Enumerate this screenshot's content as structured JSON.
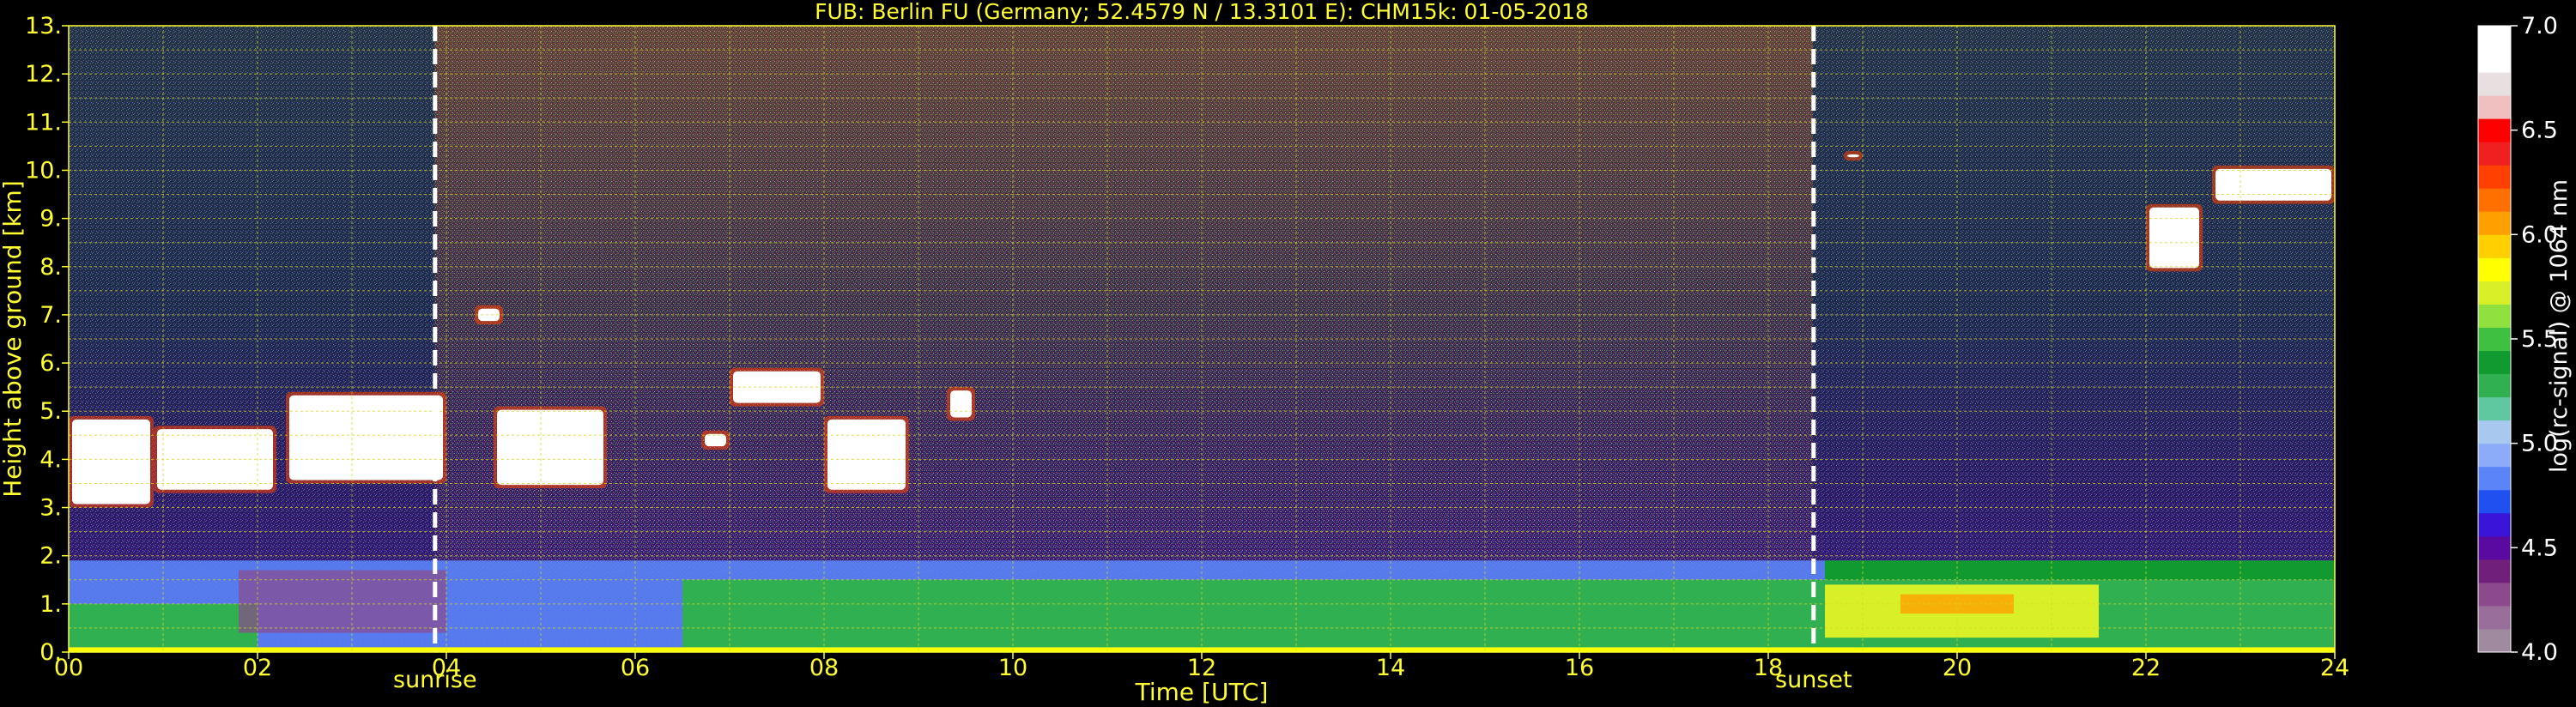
{
  "chart_data": {
    "type": "heatmap",
    "title": "FUB: Berlin FU (Germany; 52.4579 N / 13.3101 E):    CHM15k: 01-05-2018",
    "xlabel": "Time [UTC]",
    "ylabel": "Height above ground [km]",
    "xlim": [
      0,
      24
    ],
    "ylim": [
      0,
      13
    ],
    "x_ticks": [
      "00",
      "02",
      "04",
      "06",
      "08",
      "10",
      "12",
      "14",
      "16",
      "18",
      "20",
      "22",
      "24"
    ],
    "y_ticks": [
      "0.",
      "1.",
      "2.",
      "3.",
      "4.",
      "5.",
      "6.",
      "7.",
      "8.",
      "9.",
      "10.",
      "11.",
      "12.",
      "13."
    ],
    "grid": true,
    "markers": [
      {
        "label": "sunrise",
        "time": 3.88
      },
      {
        "label": "sunset",
        "time": 18.48
      }
    ],
    "colorbar": {
      "label": "log(rc-signal) @ 1064 nm",
      "range": [
        4.0,
        7.0
      ],
      "ticks": [
        "4.0",
        "4.5",
        "5.0",
        "5.5",
        "6.0",
        "6.5",
        "7.0"
      ],
      "colors": [
        "#a08aa0",
        "#9a6e9a",
        "#8c4a8c",
        "#70207a",
        "#5a0aa0",
        "#3a14d8",
        "#2050f0",
        "#5a84f8",
        "#8cacfa",
        "#a8c8f0",
        "#60c8a0",
        "#30b050",
        "#109a30",
        "#40c040",
        "#90e040",
        "#d8f028",
        "#ffff00",
        "#ffd000",
        "#ffa000",
        "#ff7000",
        "#ff4000",
        "#f02020",
        "#ff0000",
        "#f0c0c0",
        "#e8e0e0",
        "#ffffff",
        "#ffffff"
      ]
    },
    "features": [
      {
        "name": "boundary layer aerosol",
        "x": [
          0,
          24
        ],
        "y": [
          0,
          1.9
        ]
      },
      {
        "name": "cloud",
        "x": [
          0,
          0.9
        ],
        "y": [
          3.0,
          4.9
        ]
      },
      {
        "name": "cloud",
        "x": [
          0.9,
          2.2
        ],
        "y": [
          3.3,
          4.7
        ]
      },
      {
        "name": "cloud",
        "x": [
          2.3,
          4.0
        ],
        "y": [
          3.5,
          5.4
        ]
      },
      {
        "name": "cloud",
        "x": [
          4.5,
          5.7
        ],
        "y": [
          3.4,
          5.1
        ]
      },
      {
        "name": "cloud",
        "x": [
          4.3,
          4.6
        ],
        "y": [
          6.8,
          7.2
        ]
      },
      {
        "name": "cloud",
        "x": [
          6.7,
          7.0
        ],
        "y": [
          4.2,
          4.6
        ]
      },
      {
        "name": "cloud",
        "x": [
          7.0,
          8.0
        ],
        "y": [
          5.1,
          5.9
        ]
      },
      {
        "name": "cloud",
        "x": [
          8.0,
          8.9
        ],
        "y": [
          3.3,
          4.9
        ]
      },
      {
        "name": "cloud",
        "x": [
          9.3,
          9.6
        ],
        "y": [
          4.8,
          5.5
        ]
      },
      {
        "name": "cloud",
        "x": [
          18.8,
          19.0
        ],
        "y": [
          10.2,
          10.4
        ]
      },
      {
        "name": "cloud",
        "x": [
          22.0,
          22.6
        ],
        "y": [
          7.9,
          9.3
        ]
      },
      {
        "name": "cloud",
        "x": [
          22.7,
          24.0
        ],
        "y": [
          9.3,
          10.1
        ]
      }
    ]
  }
}
